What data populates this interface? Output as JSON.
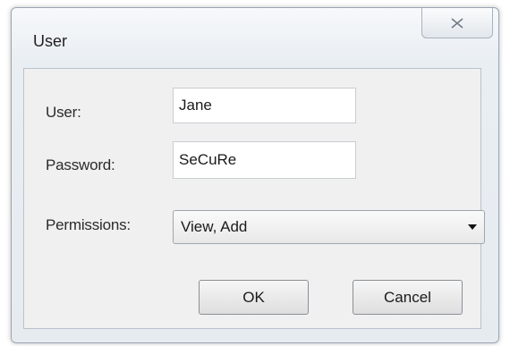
{
  "window": {
    "title": "User",
    "close_icon": "close-icon"
  },
  "form": {
    "user_label": "User:",
    "user_value": "Jane",
    "password_label": "Password:",
    "password_value": "SeCuRe",
    "permissions_label": "Permissions:",
    "permissions_value": "View, Add",
    "dropdown_icon": "chevron-down-icon"
  },
  "buttons": {
    "ok_label": "OK",
    "cancel_label": "Cancel"
  }
}
